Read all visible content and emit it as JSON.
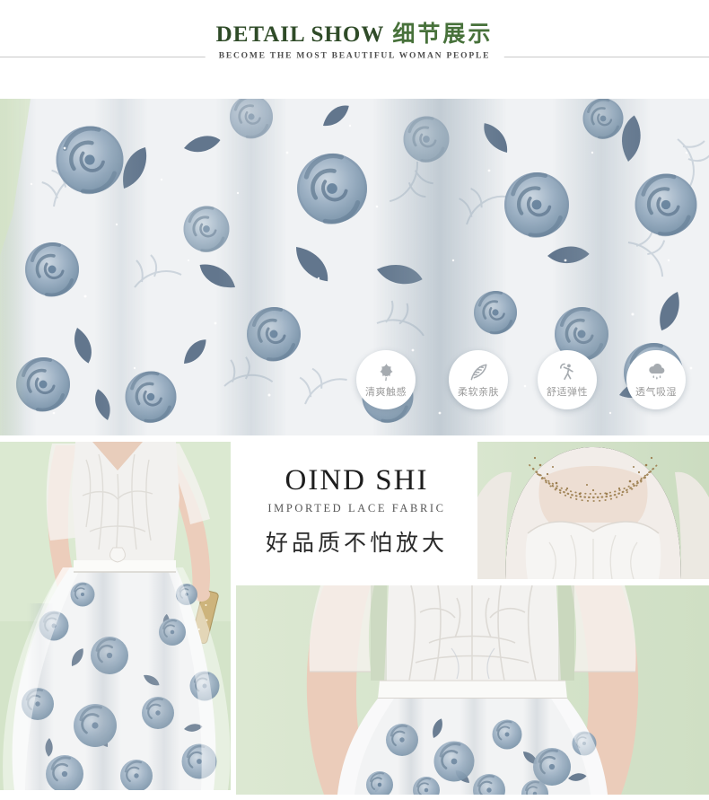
{
  "header": {
    "title_en": "DETAIL SHOW",
    "title_cn": "细节展示",
    "subtitle": "BECOME THE MOST BEAUTIFUL WOMAN PEOPLE"
  },
  "features": {
    "badges": [
      {
        "icon": "maple-leaf-icon",
        "label": "清爽触感"
      },
      {
        "icon": "feather-icon",
        "label": "柔软亲肤"
      },
      {
        "icon": "stretch-person-icon",
        "label": "舒适弹性"
      },
      {
        "icon": "rain-cloud-icon",
        "label": "透气吸湿"
      }
    ]
  },
  "promo": {
    "brand": "OIND SHI",
    "tagline": "IMPORTED LACE FABRIC",
    "slogan": "好品质不怕放大"
  },
  "colors": {
    "title_green": "#2f4b28",
    "accent_green": "#47713a",
    "rule_gray": "#c9c9c9",
    "badge_text_gray": "#9a9a9a",
    "icon_gray": "#a6abb0",
    "bg_sage_green": "#dbe8d2",
    "floral_blue": "#8ba3b8",
    "floral_slate": "#49607a",
    "bead_gold": "#a3875a",
    "text_dark": "#2a2a2a"
  }
}
